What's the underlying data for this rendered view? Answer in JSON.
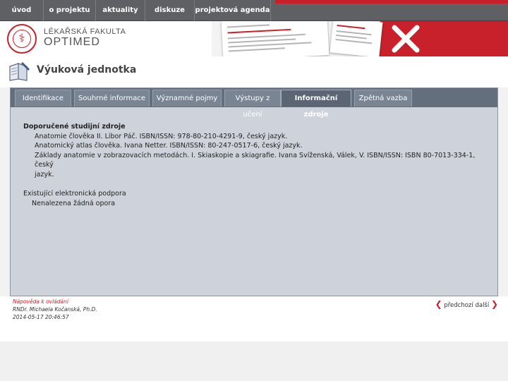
{
  "nav": {
    "items": [
      {
        "label": "úvod"
      },
      {
        "label": "o projektu"
      },
      {
        "label": "aktuality"
      },
      {
        "label": "diskuze"
      },
      {
        "label": "projektová agenda"
      }
    ]
  },
  "header": {
    "logo_title": "LÉKAŘSKÁ FAKULTA",
    "logo_brand": "OPTIMED"
  },
  "page": {
    "title": "Výuková jednotka"
  },
  "tabs": [
    {
      "label": "Identifikace"
    },
    {
      "label": "Souhrné informace"
    },
    {
      "label": "Významné pojmy"
    },
    {
      "label": "Výstupy z učení"
    },
    {
      "label": "Informační zdroje"
    },
    {
      "label": "Zpětná vazba"
    }
  ],
  "content": {
    "recommended_heading": "Doporučené studijní zdroje",
    "sources": [
      "Anatomie člověka II. Libor Páč. ISBN/ISSN: 978-80-210-4291-9, český jazyk.",
      "Anatomický atlas člověka. Ivana Netter. ISBN/ISSN: 80-247-0517-6, český jazyk.",
      "Základy anatomie v zobrazovacích metodách. I. Skiaskopie a skiagrafie. Ivana Svíženská, Válek, V. ISBN/ISSN: ISBN 80-7013-334-1, český",
      "jazyk."
    ],
    "support_heading": "Existující elektronická podpora",
    "support_none": "Nenalezena žádná opora"
  },
  "footer": {
    "link": "Nápověda k ovládání",
    "author": "RNDr. Michaela Kočanská, Ph.D.",
    "date": "2014-05-17 20:46:57",
    "prev": "předchozí",
    "next": "další"
  },
  "colors": {
    "brand_red": "#c8202a",
    "nav_bg": "#5e6064",
    "panel_bg": "#ced3db",
    "tabbar_bg": "#646f7d"
  }
}
